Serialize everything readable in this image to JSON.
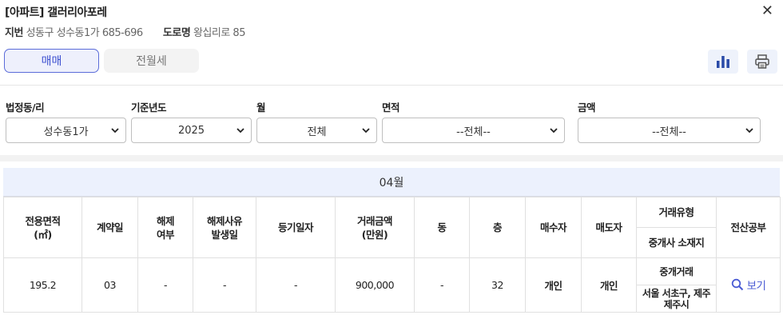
{
  "header": {
    "title": "[아파트] 갤러리아포레",
    "jibun_label": "지번",
    "jibun_value": "성동구 성수동1가 685-696",
    "road_label": "도로명",
    "road_value": "왕십리로 85"
  },
  "tabs": [
    {
      "label": "매매",
      "selected": true
    },
    {
      "label": "전월세",
      "selected": false
    }
  ],
  "toolbar_icons": [
    "bar-chart-icon",
    "print-icon"
  ],
  "filters": [
    {
      "label": "법정동/리",
      "value": "성수동1가"
    },
    {
      "label": "기준년도",
      "value": "2025"
    },
    {
      "label": "월",
      "value": "전체"
    },
    {
      "label": "면적",
      "value": "--전체--"
    },
    {
      "label": "금액",
      "value": "--전체--"
    }
  ],
  "table": {
    "month": "04월",
    "headers": {
      "area": "전용면적\n(㎡)",
      "contract_day": "계약일",
      "cancel": "해제\n여부",
      "cancel_date": "해제사유\n발생일",
      "register_date": "등기일자",
      "price": "거래금액\n(만원)",
      "dong": "동",
      "floor": "층",
      "buyer": "매수자",
      "seller": "매도자",
      "deal_type": "거래유형",
      "broker_location": "중개사 소재지",
      "doc": "전산공부"
    },
    "rows": [
      {
        "area": "195.2",
        "contract_day": "03",
        "cancel": "-",
        "cancel_date": "-",
        "register_date": "-",
        "price": "900,000",
        "dong": "-",
        "floor": "32",
        "buyer": "개인",
        "seller": "개인",
        "deal_type": "중개거래",
        "broker_location": "서울 서초구, 제주 제주시",
        "doc_link": "보기"
      }
    ]
  },
  "colors": {
    "accent": "#3c4fd0",
    "month_bar": "#ecf1fd"
  }
}
